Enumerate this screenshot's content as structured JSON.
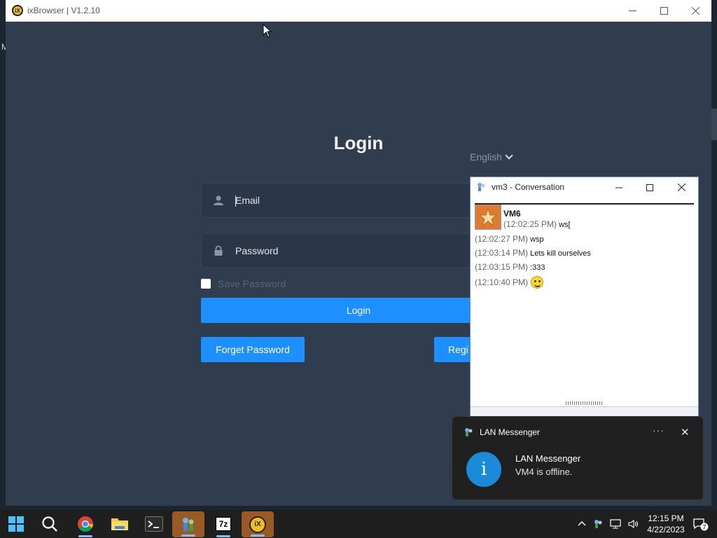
{
  "desktop": {
    "edge_letter": "M"
  },
  "ixbrowser": {
    "window_title": "ixBrowser | V1.2.10",
    "logo_text": "iX",
    "controls": {
      "minimize": "—",
      "maximize": "☐",
      "close": "✕"
    },
    "login": {
      "title": "Login",
      "language": "English",
      "email_placeholder": "Email",
      "password_placeholder": "Password",
      "save_password_label": "Save Password",
      "login_button": "Login",
      "forget_password_button": "Forget Password",
      "register_button_visible": "Regi"
    }
  },
  "conversation": {
    "window_title": "vm3 - Conversation",
    "controls": {
      "minimize": "—",
      "maximize": "☐",
      "close": "✕"
    },
    "sender": "VM6",
    "messages": [
      {
        "time": "(12:02:25 PM)",
        "text": "ws["
      },
      {
        "time": "(12:02:27 PM)",
        "text": "wsp"
      },
      {
        "time": "(12:03:14 PM)",
        "text": "Lets kill ourselves"
      },
      {
        "time": "(12:03:15 PM)",
        "text": ":333"
      },
      {
        "time": "(12:10:40 PM)",
        "text": "",
        "emoji": "smiley-icon"
      }
    ]
  },
  "toast": {
    "app_name": "LAN Messenger",
    "more": "···",
    "close": "✕",
    "heading": "LAN Messenger",
    "body": "VM4 is offline.",
    "info_glyph": "i"
  },
  "taskbar": {
    "apps": [
      "start-icon",
      "search-icon",
      "chrome-icon",
      "file-explorer-icon",
      "terminal-icon",
      "lan-messenger-icon",
      "7zip-icon",
      "ixbrowser-icon"
    ],
    "seven_zip_label": "7z",
    "ix_label": "iX",
    "clock_time": "12:15 PM",
    "clock_date": "4/22/2023",
    "notification_count": "7",
    "accent": "#1e8fff"
  }
}
